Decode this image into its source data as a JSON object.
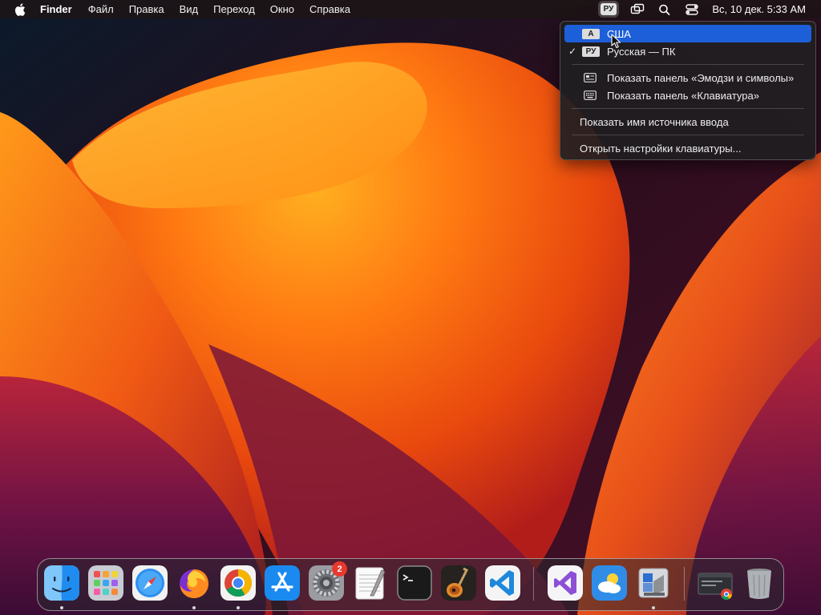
{
  "menubar": {
    "app_name": "Finder",
    "menus": [
      "Файл",
      "Правка",
      "Вид",
      "Переход",
      "Окно",
      "Справка"
    ],
    "input_source": "РУ",
    "clock": "Вс, 10 дек.  5:33 AM",
    "icons": [
      "apple-logo-icon",
      "screen-mirroring-icon",
      "spotlight-search-icon",
      "control-center-icon"
    ]
  },
  "input_menu": {
    "sources": [
      {
        "badge": "A",
        "label": "США",
        "checked": false,
        "highlighted": true
      },
      {
        "badge": "РУ",
        "label": "Русская — ПК",
        "checked": true,
        "highlighted": false
      }
    ],
    "check_mark": "✓",
    "panels": [
      "Показать панель «Эмодзи и символы»",
      "Показать панель «Клавиатура»"
    ],
    "show_source_name": "Показать имя источника ввода",
    "open_settings": "Открыть настройки клавиатуры..."
  },
  "dock": {
    "apps": [
      {
        "name": "finder",
        "running": true
      },
      {
        "name": "launchpad",
        "running": false
      },
      {
        "name": "safari",
        "running": false
      },
      {
        "name": "firefox",
        "running": true
      },
      {
        "name": "chrome",
        "running": true
      },
      {
        "name": "app-store",
        "running": false
      },
      {
        "name": "system-settings",
        "running": false,
        "badge": "2"
      },
      {
        "name": "textedit",
        "running": false
      },
      {
        "name": "terminal",
        "running": false
      },
      {
        "name": "garageband",
        "running": false
      },
      {
        "name": "vscode",
        "running": false
      },
      {
        "name": "visual-studio",
        "running": false
      },
      {
        "name": "weather",
        "running": false
      },
      {
        "name": "boot-camp-assistant",
        "running": true
      },
      {
        "name": "chrome-window-stack",
        "running": false
      },
      {
        "name": "trash",
        "running": false
      }
    ]
  },
  "colors": {
    "highlight": "#1d5fd9",
    "badge": "#e8392e"
  }
}
